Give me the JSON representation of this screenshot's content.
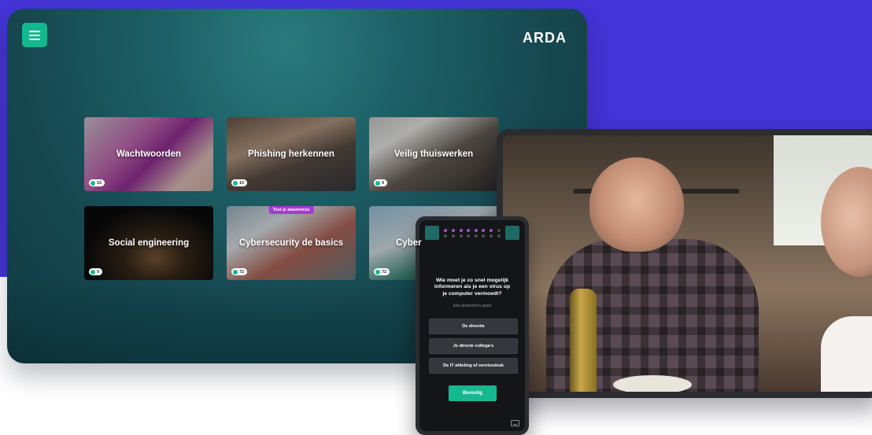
{
  "colors": {
    "background_band": "#4433d6",
    "accent_green": "#14b88d",
    "tag_purple": "#a23bd4",
    "progress_dot_active": "#b548d6"
  },
  "app": {
    "menu_icon": "hamburger-menu-icon",
    "logo": "ARDA"
  },
  "courses": [
    {
      "title": "Wachtwoorden",
      "count": "15",
      "tag": ""
    },
    {
      "title": "Phishing herkennen",
      "count": "10",
      "tag": ""
    },
    {
      "title": "Veilig thuiswerken",
      "count": "9",
      "tag": ""
    },
    {
      "title": "Social engineering",
      "count": "9",
      "tag": ""
    },
    {
      "title": "Cybersecurity de basics",
      "count": "72",
      "tag": "Test je awareness"
    },
    {
      "title": "Cyber",
      "count": "72",
      "tag": ""
    }
  ],
  "quiz": {
    "question": "Wie moet je zo snel mogelijk informeren als je een virus op je computer vermoedt?",
    "hint": "Eén antwoord is goed",
    "answers": [
      "De directie",
      "Je directe collega's",
      "De IT afdeling of servicedesk"
    ],
    "confirm_label": "Bevestig",
    "progress": {
      "total_steps": 16,
      "completed_steps": 7
    },
    "subtitles_icon": "subtitles-icon"
  }
}
